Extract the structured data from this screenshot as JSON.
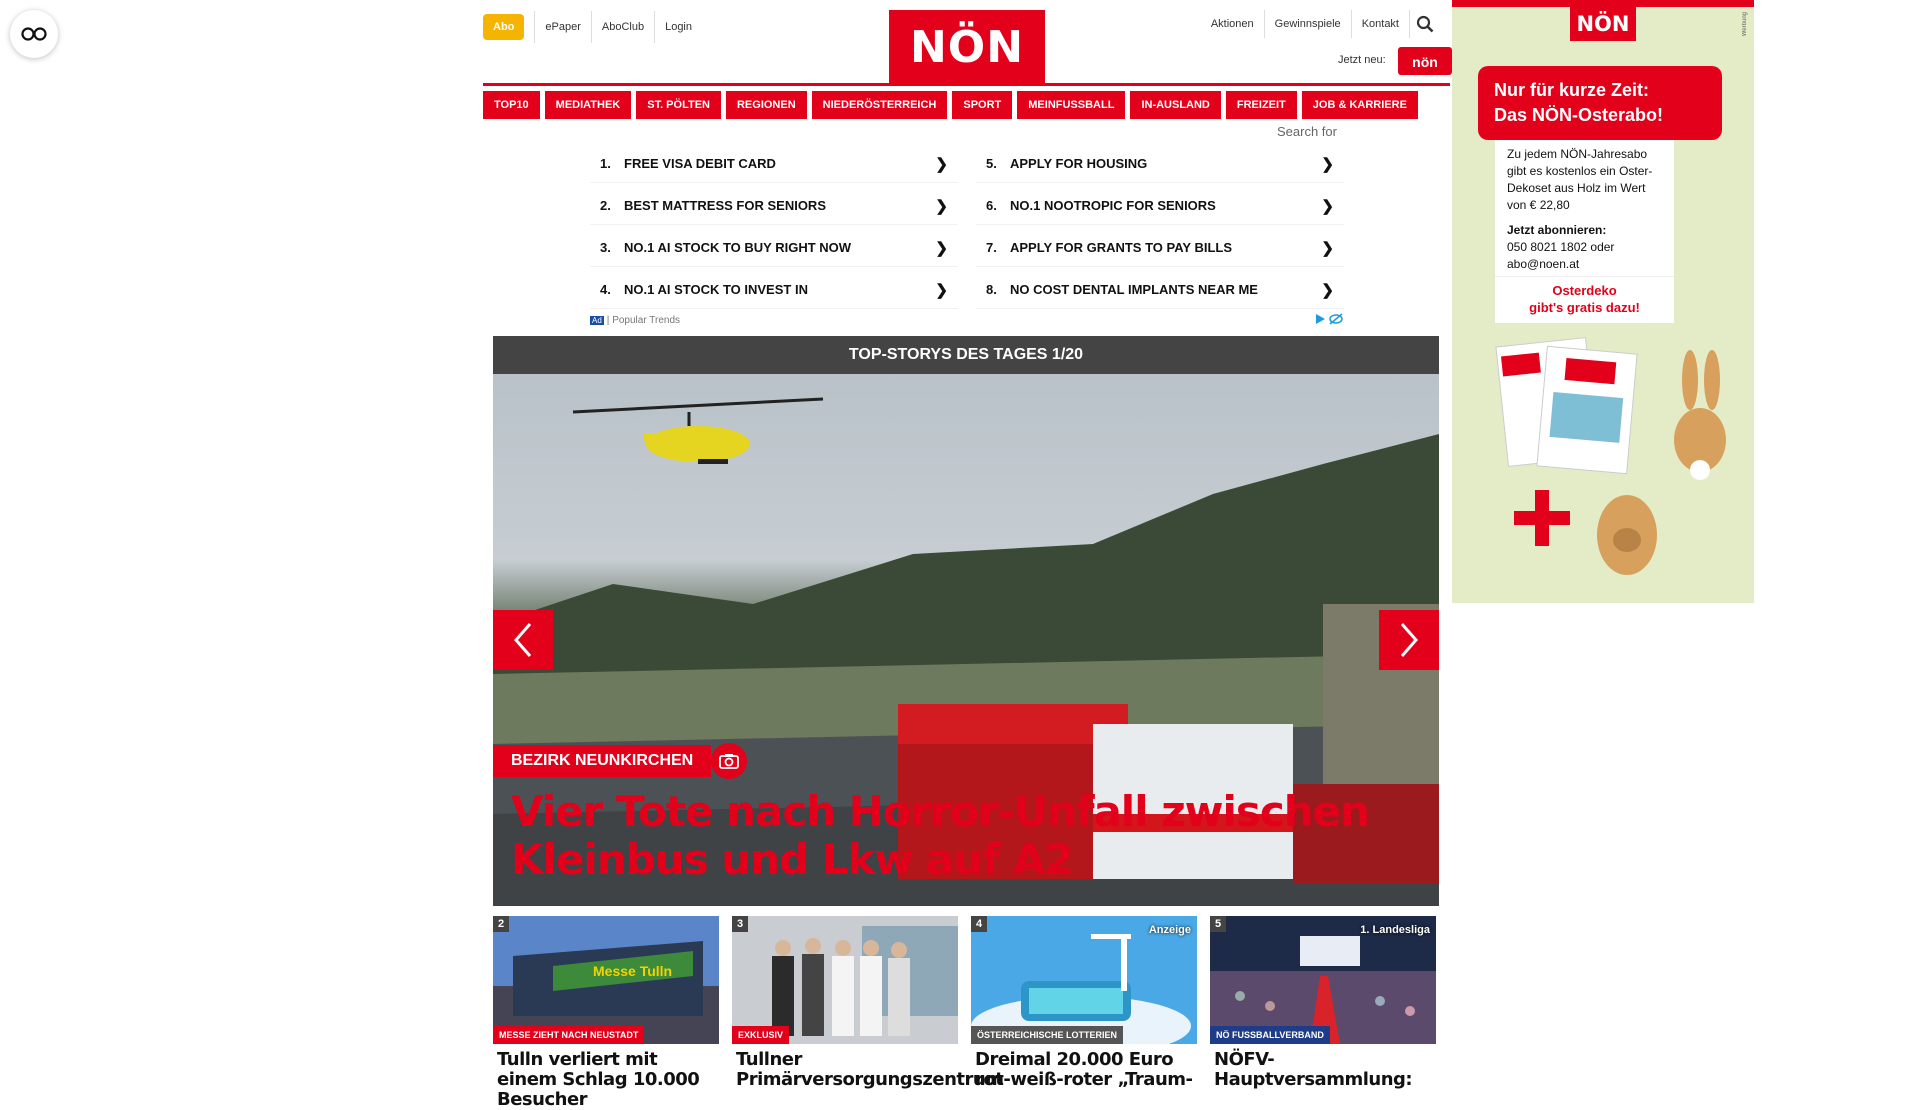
{
  "header": {
    "abo_label": "Abo",
    "top_links": [
      "ePaper",
      "AboClub",
      "Login"
    ],
    "logo_text": "NÖN",
    "right_links": [
      "Aktionen",
      "Gewinnspiele",
      "Kontakt"
    ],
    "jetzt_neu": "Jetzt neu:",
    "jetzt_logo": "nön"
  },
  "nav": {
    "items": [
      "TOP10",
      "MEDIATHEK",
      "ST. PÖLTEN",
      "REGIONEN",
      "NIEDERÖSTERREICH",
      "SPORT",
      "MEINFUSSBALL",
      "IN-AUSLAND",
      "FREIZEIT",
      "JOB & KARRIERE"
    ],
    "search_placeholder": "Search for"
  },
  "ads": {
    "left": [
      {
        "num": "1.",
        "text": "FREE VISA DEBIT CARD"
      },
      {
        "num": "2.",
        "text": "BEST MATTRESS FOR SENIORS"
      },
      {
        "num": "3.",
        "text": "NO.1 AI STOCK TO BUY RIGHT NOW"
      },
      {
        "num": "4.",
        "text": "NO.1 AI STOCK TO INVEST IN"
      }
    ],
    "right": [
      {
        "num": "5.",
        "text": "APPLY FOR HOUSING"
      },
      {
        "num": "6.",
        "text": "NO.1 NOOTROPIC FOR SENIORS"
      },
      {
        "num": "7.",
        "text": "APPLY FOR GRANTS TO PAY BILLS"
      },
      {
        "num": "8.",
        "text": "NO COST DENTAL IMPLANTS NEAR ME"
      }
    ],
    "arrow": "❯",
    "ad_badge": "Ad",
    "footer": "Popular Trends"
  },
  "top_stories": {
    "bar_title": "TOP-STORYS DES TAGES 1/20",
    "hero_kicker": "BEZIRK NEUNKIRCHEN",
    "hero_title": "Vier Tote nach Horror-Unfall zwischen Kleinbus und Lkw auf A2"
  },
  "cards": [
    {
      "num": "2",
      "kicker": "MESSE ZIEHT NACH NEUSTADT",
      "title": "Tulln verliert mit einem Schlag 10.000 Besucher",
      "tag": ""
    },
    {
      "num": "3",
      "kicker": "EXKLUSIV",
      "title": "Tullner Primärversorgungszentrum",
      "tag": ""
    },
    {
      "num": "4",
      "kicker": "ÖSTERREICHISCHE LOTTERIEN",
      "title": "Dreimal 20.000 Euro rot-weiß-roter „Traum-",
      "tag": "Anzeige"
    },
    {
      "num": "5",
      "kicker": "NÖ FUSSBALLVERBAND",
      "title": "NÖFV-Hauptversammlung:",
      "tag": "1. Landesliga"
    }
  ],
  "promo": {
    "logo": "NÖN",
    "headline_1": "Nur für kurze Zeit:",
    "headline_2": "Das NÖN-Osterabo!",
    "body": "Zu jedem NÖN-Jahresabo gibt es kostenlos ein Oster-Dekoset aus Holz im Wert von € 22,80",
    "cta_title": "Jetzt abonnieren:",
    "cta_contact": "050 8021 1802 oder abo@noen.at",
    "osterdeko_1": "Osterdeko",
    "osterdeko_2": "gibt's gratis dazu!",
    "side_text": "Werbung"
  },
  "colors": {
    "brand_red": "#e2001a",
    "abo_yellow": "#f5b400",
    "bar_gray": "#444444"
  }
}
